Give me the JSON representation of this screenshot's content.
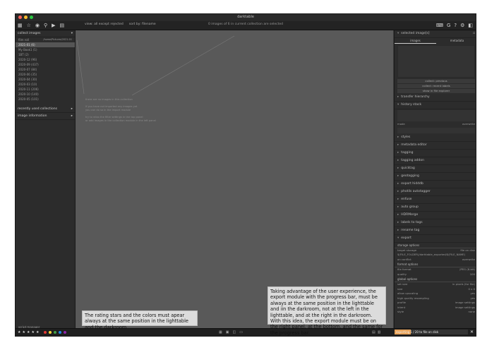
{
  "window": {
    "title": "darktable"
  },
  "toolbar": {
    "view_label": "view: all except rejected",
    "sort_label": "sort by: filename",
    "center_message": "0 images of 6 in current collection are selected"
  },
  "left": {
    "collect_header": "collect images",
    "film_roll_label": "film roll",
    "film_roll_path": "/home/Pictures/2021-01",
    "rows": [
      "2021-01 (6)",
      "My Book1 (1)",
      "1BT (2)",
      "2020-12 (96)",
      "2020-09 (437)",
      "2020-07 (84)",
      "2020-06 (35)",
      "2020-04 (30)",
      "2020-03 (10)",
      "2020-11 (206)",
      "2020-10 (140)",
      "2020-05 (101)"
    ],
    "recent_header": "recently used collections",
    "info_header": "image information",
    "script_manager": "script manager"
  },
  "center": {
    "empty_lines": [
      "there are no images in this collection",
      "",
      "if you have not imported any images yet",
      "you can do so in the import module",
      "",
      "try to relax the filter settings in the top panel",
      "or add images in the collection module in the left panel"
    ]
  },
  "right": {
    "selected_header": "selected image[s]",
    "tabs": [
      "images",
      "metadata"
    ],
    "buttons": [
      "collect: previous",
      "collect: recent labels",
      "show in file explorer"
    ],
    "modules": [
      "transfer hierarchy",
      "history stack"
    ],
    "mode_label": "mode",
    "mode_value": "overwrite",
    "modules2": [
      "styles",
      "metadata editor",
      "tagging",
      "tagging addon",
      "quicktag",
      "geotagging",
      "export hidddb",
      "photils autotagger",
      "enfuse",
      "auto group",
      "HDRMerge",
      "labels to tags",
      "rename tag",
      "export"
    ],
    "storage_header": "storage options",
    "storage": [
      {
        "k": "target storage",
        "v": "file on disk"
      },
      {
        "k": "$(FILE_FOLDER)/darktable_exported/$(FILE_NAME)",
        "v": ""
      },
      {
        "k": "on conflict",
        "v": "overwrite"
      }
    ],
    "format_header": "format options",
    "format": [
      {
        "k": "file format",
        "v": "JPEG (8-bit)"
      },
      {
        "k": "quality",
        "v": "100"
      }
    ],
    "global_header": "global options",
    "global": [
      {
        "k": "set size",
        "v": "in pixels (for file)"
      },
      {
        "k": "size",
        "v": "0 x 0"
      },
      {
        "k": "allow upscaling",
        "v": "yes"
      },
      {
        "k": "high quality resampling",
        "v": "yes"
      },
      {
        "k": "profile",
        "v": "image settings"
      },
      {
        "k": "intent",
        "v": "image settings"
      },
      {
        "k": "style",
        "v": "none"
      }
    ]
  },
  "bottom": {
    "stars": [
      "★",
      "★",
      "★",
      "★",
      "★"
    ],
    "colors": [
      "#e53935",
      "#fdd835",
      "#43a047",
      "#1e88e5",
      "#8e24aa"
    ],
    "progress_label": "exporting 1 / 20 to file on disk",
    "progress_fraction": 0.22,
    "close": "✕"
  },
  "notes": {
    "stars_note": "The rating stars and the colors must apear always at the same position in the lighttable and the darkroom.",
    "export_note": "Taking advantage of the user experience, the export module with the progress bar, must be always at the same position in the lighttable and iin the darkroom, not at the left in the lighttable, and at the right in the darkroom. With this idea, the export module must be on the right panel, at the bottom, and the same for the progress bar."
  }
}
